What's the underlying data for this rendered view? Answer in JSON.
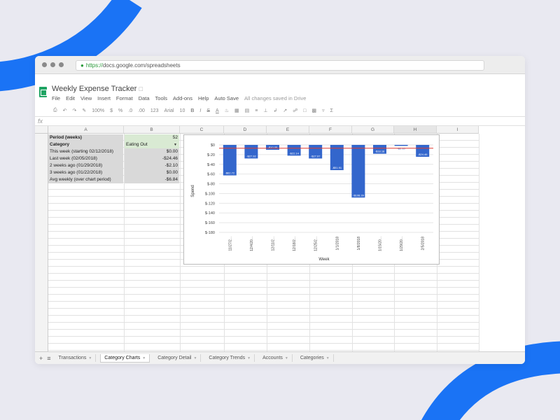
{
  "colors": {
    "background": "#e9e9f1",
    "accent": "#1a73f5",
    "bar": "#3366cc",
    "avg_line": "#e03c31"
  },
  "browser": {
    "url_scheme": "https://",
    "url_rest": "docs.google.com/spreadsheets"
  },
  "app": {
    "title": "Weekly Expense Tracker",
    "menu": [
      "File",
      "Edit",
      "View",
      "Insert",
      "Format",
      "Data",
      "Tools",
      "Add-ons",
      "Help",
      "Auto Save"
    ],
    "save_status": "All changes saved in Drive"
  },
  "toolbar": {
    "zoom": "100%",
    "currency": "$",
    "percent": "%",
    "decimals_less": ".0",
    "decimals_more": ".00",
    "number_format": "123",
    "font": "Arial",
    "font_size": "10",
    "bold": "B",
    "italic": "I",
    "strike": "S",
    "text_color": "A"
  },
  "formula_bar": {
    "fx": "fx"
  },
  "columns": [
    "A",
    "B",
    "C",
    "D",
    "E",
    "F",
    "G",
    "H",
    "I"
  ],
  "table": {
    "rows": [
      {
        "label": "Period (weeks)",
        "value": "52"
      },
      {
        "label": "Category",
        "value": "Eating Out"
      },
      {
        "label": "This week (starting 02/12/2018)",
        "value": "$0.00"
      },
      {
        "label": "Last week (02/05/2018)",
        "value": "-$24.46"
      },
      {
        "label": "2 weeks ago (01/29/2018)",
        "value": "-$2.10"
      },
      {
        "label": "3 weeks ago (01/22/2018)",
        "value": "$0.00"
      },
      {
        "label": "Avg weekly (over chart period)",
        "value": "-$6.84"
      }
    ]
  },
  "chart_data": {
    "type": "bar",
    "categories": [
      "11/27/2...",
      "12/4/20...",
      "12/11/2...",
      "12/18/2...",
      "12/25/2...",
      "1/1/2018",
      "1/8/2018",
      "1/15/20...",
      "1/29/20...",
      "2/5/2018"
    ],
    "values": [
      -62.72,
      -27.92,
      -10.05,
      -22.14,
      -27.97,
      -51.91,
      -108.39,
      -18.18,
      -2.1,
      -24.46
    ],
    "data_labels": [
      "-$62.72",
      "-$27.92",
      "-$10.05",
      "-$22.14",
      "-$27.97",
      "-$51.91",
      "-$108.39",
      "-$18.18",
      "-$2.10",
      "-$24.46"
    ],
    "average": -6.84,
    "yticks": [
      "$0",
      "$-20",
      "$-40",
      "$-60",
      "$-80",
      "$-100",
      "$-120",
      "$-140",
      "$-160",
      "$-180"
    ],
    "ytick_values": [
      0,
      -20,
      -40,
      -60,
      -80,
      -100,
      -120,
      -140,
      -160,
      -180
    ],
    "ylim": [
      -180,
      0
    ],
    "xlabel": "Week",
    "ylabel": "Spend",
    "grid": true
  },
  "sheet_tabs": [
    "Transactions",
    "Category Charts",
    "Category Detail",
    "Category Trends",
    "Accounts",
    "Categories"
  ],
  "active_tab": "Category Charts"
}
